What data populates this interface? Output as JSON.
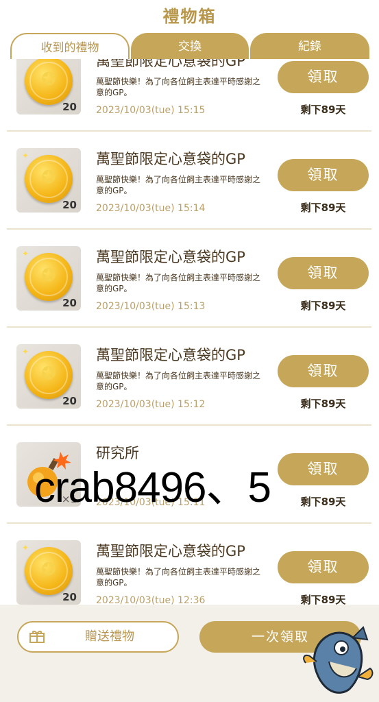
{
  "header": {
    "title": "禮物箱"
  },
  "tabs": [
    {
      "label": "收到的禮物",
      "active": true
    },
    {
      "label": "交換",
      "active": false
    },
    {
      "label": "紀錄",
      "active": false
    }
  ],
  "items": [
    {
      "title": "萬聖節限定心意袋的GP",
      "desc": "萬聖節快樂！為了向各位飼主表達平時感謝之意的GP。",
      "time": "2023/10/03(tue) 15:15",
      "qty": "20",
      "claim": "領取",
      "remain": "剩下89天",
      "icon": "gp-coin-icon"
    },
    {
      "title": "萬聖節限定心意袋的GP",
      "desc": "萬聖節快樂！為了向各位飼主表達平時感謝之意的GP。",
      "time": "2023/10/03(tue) 15:14",
      "qty": "20",
      "claim": "領取",
      "remain": "剩下89天",
      "icon": "gp-coin-icon"
    },
    {
      "title": "萬聖節限定心意袋的GP",
      "desc": "萬聖節快樂！為了向各位飼主表達平時感謝之意的GP。",
      "time": "2023/10/03(tue) 15:13",
      "qty": "20",
      "claim": "領取",
      "remain": "剩下89天",
      "icon": "gp-coin-icon"
    },
    {
      "title": "萬聖節限定心意袋的GP",
      "desc": "萬聖節快樂！為了向各位飼主表達平時感謝之意的GP。",
      "time": "2023/10/03(tue) 15:12",
      "qty": "20",
      "claim": "領取",
      "remain": "剩下89天",
      "icon": "gp-coin-icon"
    },
    {
      "title": "研究所",
      "desc": "",
      "time": "2023/10/03(tue) 15:11",
      "qty": "×1",
      "claim": "領取",
      "remain": "剩下89天",
      "icon": "bomb-icon"
    },
    {
      "title": "萬聖節限定心意袋的GP",
      "desc": "萬聖節快樂！為了向各位飼主表達平時感謝之意的GP。",
      "time": "2023/10/03(tue) 12:36",
      "qty": "20",
      "claim": "領取",
      "remain": "剩下89天",
      "icon": "gp-coin-icon"
    }
  ],
  "footer": {
    "gift_label": "贈送禮物",
    "claim_all_label": "一次領取"
  },
  "overlay": {
    "watermark": "crab8496、5"
  },
  "colors": {
    "accent": "#c6a75a",
    "accent_text": "#b89650",
    "title_text": "#4a3820",
    "time_text": "#b9a06a"
  }
}
